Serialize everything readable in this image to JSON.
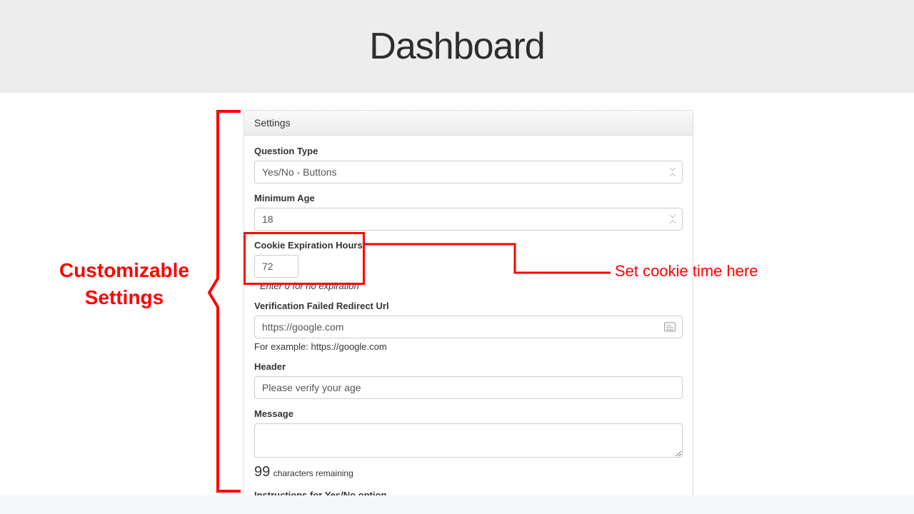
{
  "header": {
    "title": "Dashboard"
  },
  "annotations": {
    "left": "Customizable\nSettings",
    "right": "Set cookie time here"
  },
  "panel": {
    "title": "Settings",
    "question_type": {
      "label": "Question Type",
      "value": "Yes/No - Buttons"
    },
    "minimum_age": {
      "label": "Minimum Age",
      "value": "18"
    },
    "cookie_expiration": {
      "label": "Cookie Expiration Hours",
      "value": "72",
      "help": "Enter 0 for no expiration"
    },
    "redirect_url": {
      "label": "Verification Failed Redirect Url",
      "value": "https://google.com",
      "help": "For example: https://google.com"
    },
    "header_field": {
      "label": "Header",
      "value": "Please verify your age"
    },
    "message": {
      "label": "Message",
      "value": "",
      "chars_remaining_num": "99",
      "chars_remaining_txt": "characters remaining"
    },
    "instructions": {
      "label_truncated": "Instructions for Yes/No option"
    }
  },
  "colors": {
    "accent_red": "#ff0000"
  }
}
